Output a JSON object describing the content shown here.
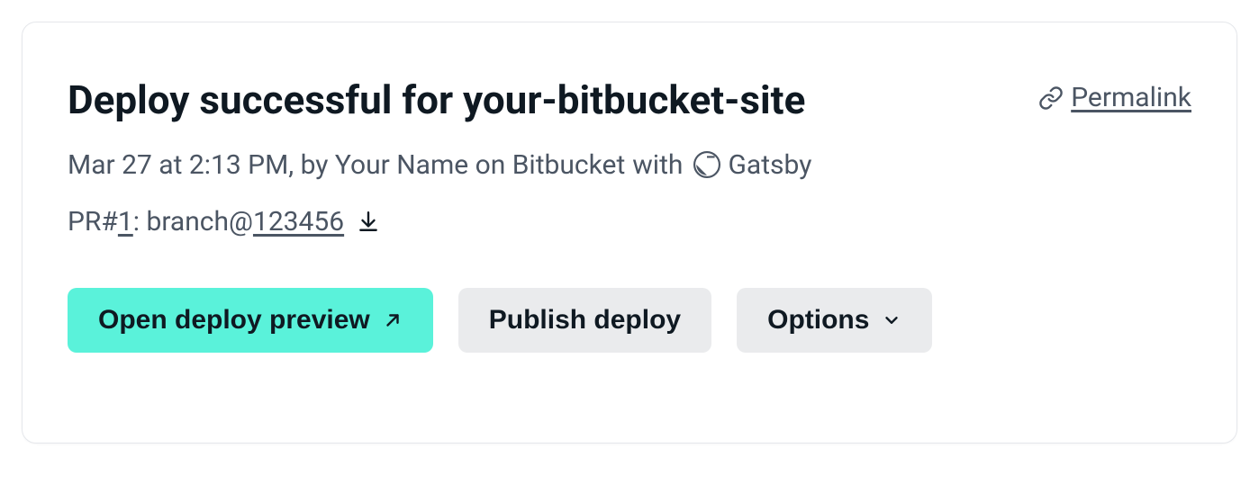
{
  "card": {
    "title": "Deploy successful for your-bitbucket-site",
    "permalink_label": "Permalink",
    "meta": {
      "datetime_author": "Mar 27 at 2:13 PM, by Your Name on Bitbucket",
      "with_word": "with",
      "framework": "Gatsby"
    },
    "pr": {
      "prefix": "PR#",
      "pr_number": "1",
      "colon_branch": ": branch@",
      "commit": "123456"
    },
    "buttons": {
      "open_preview": "Open deploy preview",
      "publish": "Publish deploy",
      "options": "Options"
    }
  }
}
